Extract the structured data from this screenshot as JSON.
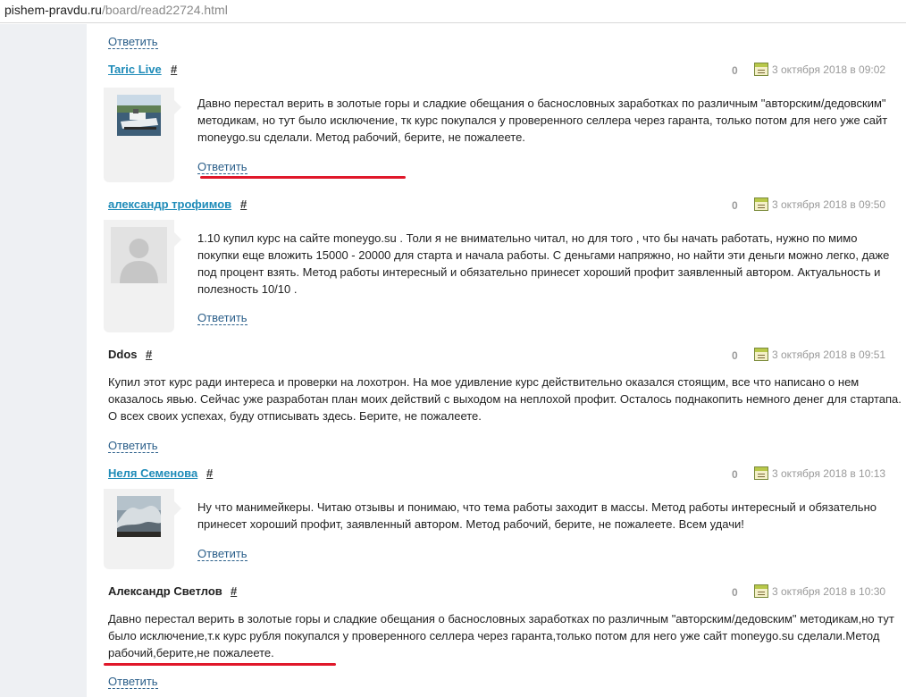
{
  "address": {
    "host": "pishem-pravdu.ru",
    "path": "/board/read22724.html"
  },
  "reply_label": "Ответить",
  "comments": [
    {
      "author": "Taric Live",
      "hash": "#",
      "rating": "0",
      "date": "3 октября 2018 в 09:02",
      "text": "Давно перестал верить в золотые горы и сладкие обещания о баснословных заработках по различным \"авторским/дедовским\" методикам, но тут было исключение, тк курс покупался у проверенного селлера через гаранта, только потом для него уже сайт moneygo.su сделали. Метод рабочий, берите, не пожалеете.",
      "avatar": "ship-photo-avatar"
    },
    {
      "author": "александр трофимов",
      "hash": "#",
      "rating": "0",
      "date": "3 октября 2018 в 09:50",
      "text": "1.10 купил курс на сайте moneygo.su . Толи я не внимательно читал, но для того , что бы начать работать, нужно по мимо покупки еще вложить 15000 - 20000 для старта и начала работы. С деньгами напряжно, но найти эти деньги можно легко, даже под процент взять. Метод работы интересный и обязательно принесет хороший профит заявленный автором. Актуальность и полезность 10/10 .",
      "avatar": "default-user-avatar"
    },
    {
      "author": "Ddos",
      "hash": "#",
      "rating": "0",
      "date": "3 октября 2018 в 09:51",
      "text": "Купил этот курс ради интереса и проверки на лохотрон. На мое удивление курс действительно оказался стоящим, все что написано о нем оказалось явью. Сейчас уже разработан план моих действий с выходом на неплохой профит. Осталось поднакопить немного денег для стартапа. О всех своих успехах, буду отписывать здесь. Берите, не пожалеете."
    },
    {
      "author": "Неля Семенова",
      "hash": "#",
      "rating": "0",
      "date": "3 октября 2018 в 10:13",
      "text": "Ну что манимейкеры. Читаю отзывы и понимаю, что тема работы заходит в массы. Метод работы интересный и обязательно принесет хороший профит, заявленный автором. Метод рабочий, берите, не пожалеете. Всем удачи!",
      "avatar": "wave-photo-avatar"
    },
    {
      "author": "Александр Светлов",
      "hash": "#",
      "rating": "0",
      "date": "3 октября 2018 в 10:30",
      "text": "Давно перестал верить в золотые горы и сладкие обещания о баснословных заработках по различным \"авторским/дедовским\" методикам,но тут было исключение,т.к курс рубля покупался у проверенного селлера через гаранта,только потом для него уже сайт moneygo.su сделали.Метод рабочий,берите,не пожалеете."
    }
  ],
  "colors": {
    "link": "#1e8bb8",
    "reply": "#2b5f8a",
    "annotation": "#e0182a",
    "meta": "#9a9a9a"
  }
}
